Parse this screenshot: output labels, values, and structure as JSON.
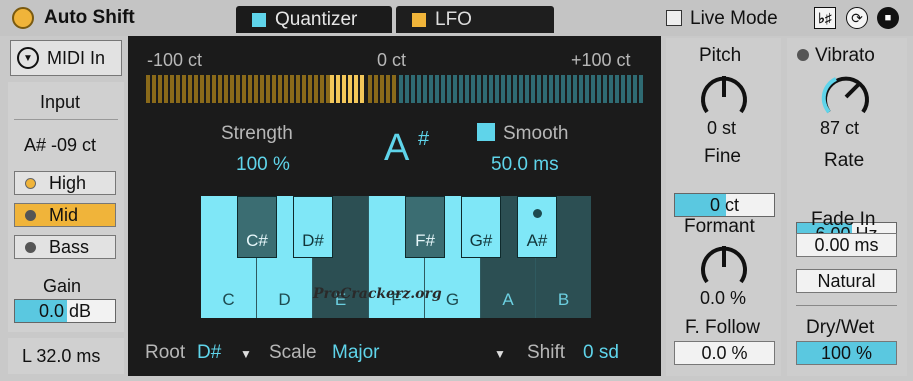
{
  "header": {
    "title": "Auto Shift",
    "tabs": [
      {
        "label": "Quantizer",
        "color": "#5fd4ea"
      },
      {
        "label": "LFO",
        "color": "#f0b43a"
      }
    ],
    "live_mode_label": "Live Mode",
    "icons": [
      "flat-sharp-icon",
      "refresh-icon",
      "save-icon"
    ]
  },
  "left": {
    "midi_label": "MIDI In",
    "input_title": "Input",
    "input_note": "A# -09 ct",
    "ranges": [
      "High",
      "Mid",
      "Bass"
    ],
    "gain_title": "Gain",
    "gain_value": "0.0 dB",
    "latency": "L 32.0 ms"
  },
  "quantizer": {
    "meter_left": "-100 ct",
    "meter_mid": "0 ct",
    "meter_right": "+100 ct",
    "strength_label": "Strength",
    "strength_value": "100 %",
    "note": "A",
    "note_accidental": "#",
    "smooth_label": "Smooth",
    "smooth_value": "50.0 ms",
    "white_keys": [
      "C",
      "D",
      "E",
      "F",
      "G",
      "A",
      "B"
    ],
    "black_keys": [
      "C#",
      "D#",
      "F#",
      "G#",
      "A#"
    ],
    "root_label": "Root",
    "root_value": "D#",
    "scale_label": "Scale",
    "scale_value": "Major",
    "shift_label": "Shift",
    "shift_value": "0 sd",
    "watermark": "ProCrackerz.org"
  },
  "pitch": {
    "title": "Pitch",
    "value": "0 st",
    "fine_title": "Fine",
    "fine_value": "0 ct",
    "formant_title": "Formant",
    "formant_value": "0.0 %",
    "follow_title": "F. Follow",
    "follow_value": "0.0 %"
  },
  "vibrato": {
    "title": "Vibrato",
    "value": "87 ct",
    "rate_title": "Rate",
    "rate_value": "6.00 Hz",
    "fade_title": "Fade In",
    "fade_value": "0.00 ms",
    "mode_value": "Natural",
    "drywet_title": "Dry/Wet",
    "drywet_value": "100 %"
  },
  "colors": {
    "accent": "#5fd4ea",
    "power": "#f0b43a",
    "panel_dark": "#1b1b1b"
  }
}
